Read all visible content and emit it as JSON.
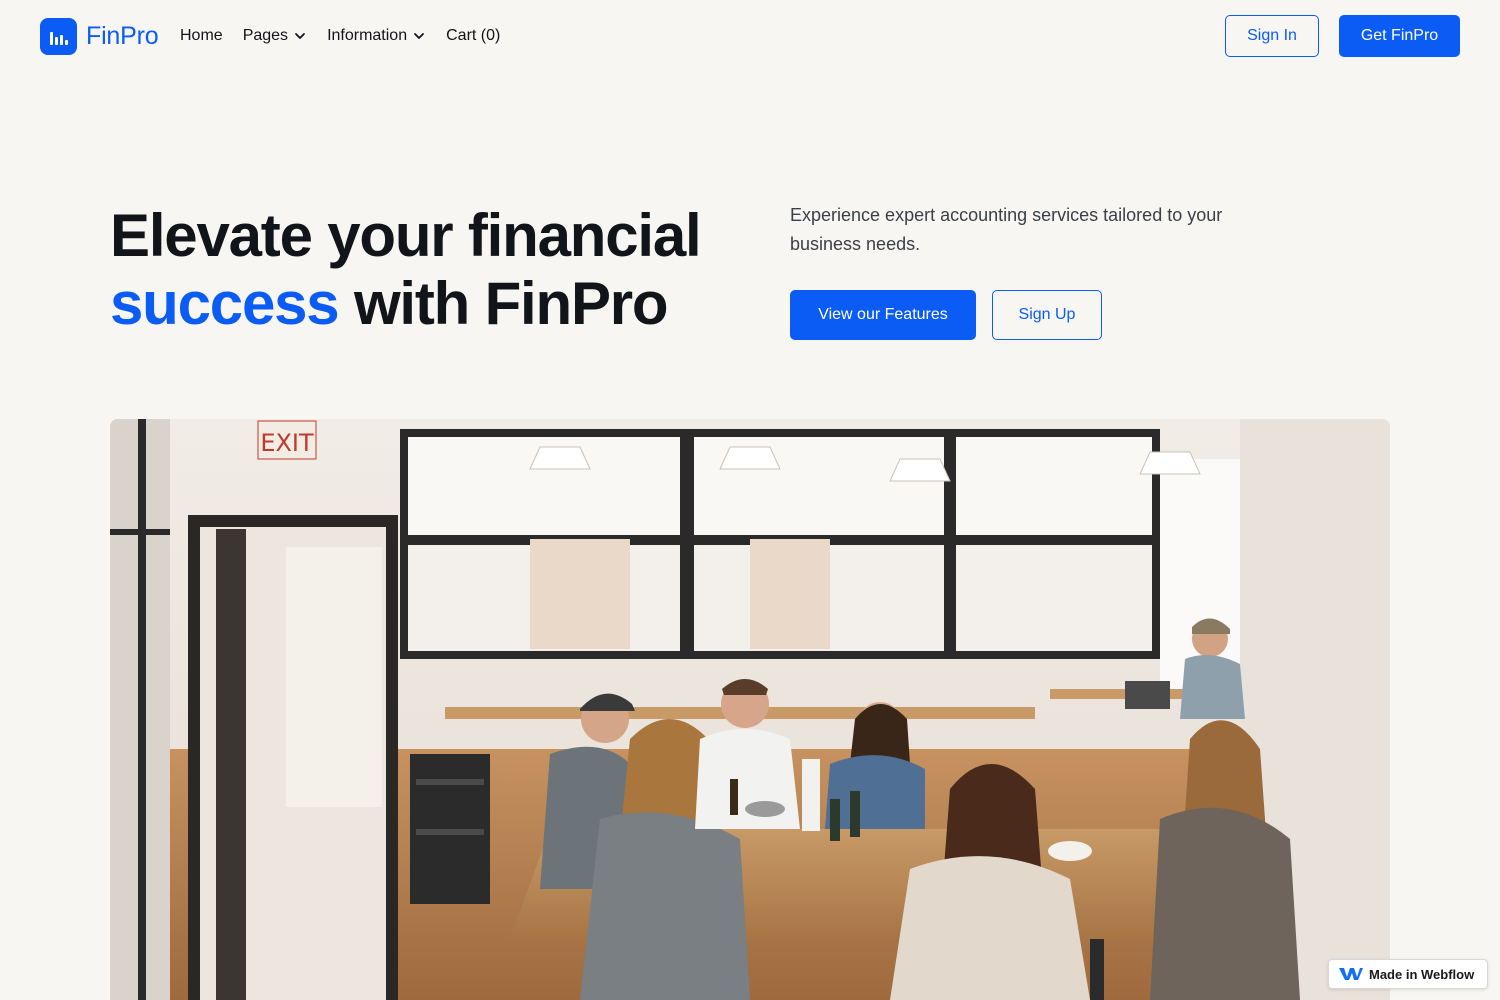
{
  "brand": {
    "name": "FinPro",
    "logo_icon": "bar-chart-icon"
  },
  "nav": {
    "items": [
      {
        "label": "Home",
        "dropdown": false
      },
      {
        "label": "Pages",
        "dropdown": true
      },
      {
        "label": "Information",
        "dropdown": true
      },
      {
        "label": "Cart (0)",
        "dropdown": false
      }
    ],
    "sign_in": "Sign In",
    "get_started": "Get FinPro"
  },
  "hero": {
    "title_line1": "Elevate your financial",
    "title_accent": "success",
    "title_rest": " with FinPro",
    "description": "Experience expert accounting services tailored to your business needs.",
    "primary_cta": "View our Features",
    "secondary_cta": "Sign Up"
  },
  "badge": {
    "label": "Made in Webflow"
  },
  "colors": {
    "brand": "#0b5cf5",
    "background": "#f7f6f3",
    "text": "#111418"
  }
}
